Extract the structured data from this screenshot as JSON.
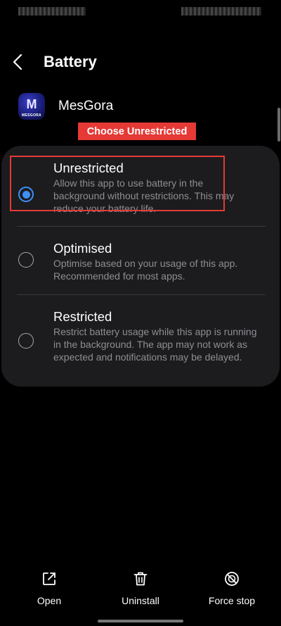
{
  "header": {
    "title": "Battery"
  },
  "app": {
    "name": "MesGora",
    "icon_letter": "M",
    "icon_wordmark": "MESGORA"
  },
  "annotation": {
    "label": "Choose Unrestricted",
    "color": "#e53935"
  },
  "options": [
    {
      "title": "Unrestricted",
      "description": "Allow this app to use battery in the background without restrictions. This may reduce your battery life.",
      "selected": true
    },
    {
      "title": "Optimised",
      "description": "Optimise based on your usage of this app. Recommended for most apps.",
      "selected": false
    },
    {
      "title": "Restricted",
      "description": "Restrict battery usage while this app is running in the background. The app may not work as expected and notifications may be delayed.",
      "selected": false
    }
  ],
  "bottom_actions": [
    {
      "label": "Open",
      "icon": "open-external-icon"
    },
    {
      "label": "Uninstall",
      "icon": "trash-icon"
    },
    {
      "label": "Force stop",
      "icon": "force-stop-icon"
    }
  ],
  "colors": {
    "accent": "#3e8ef7",
    "background": "#000000",
    "card": "#1c1c1e"
  }
}
